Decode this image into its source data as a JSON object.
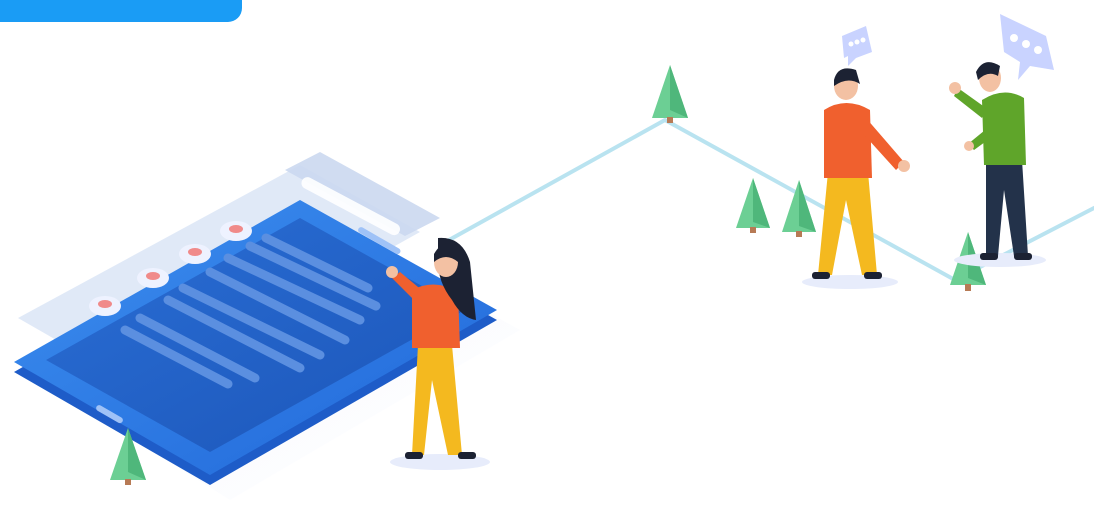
{
  "colors": {
    "background": "#ffffff",
    "accent_blue": "#1a9cf5",
    "tablet_blue": "#2f7fe6",
    "tablet_screen": "#1f5fc8",
    "path_line": "#b9e3f0",
    "tree_green": "#6ccf94",
    "shirt_orange": "#f0602e",
    "pants_yellow": "#f4b91f",
    "shirt_green": "#5fa52a",
    "pants_navy": "#23324a",
    "hair_dark": "#1c2233",
    "skin": "#f3c1a3",
    "bubble": "#c9d3ff"
  },
  "icons": [
    "tree-icon",
    "chat-bubble-icon"
  ]
}
